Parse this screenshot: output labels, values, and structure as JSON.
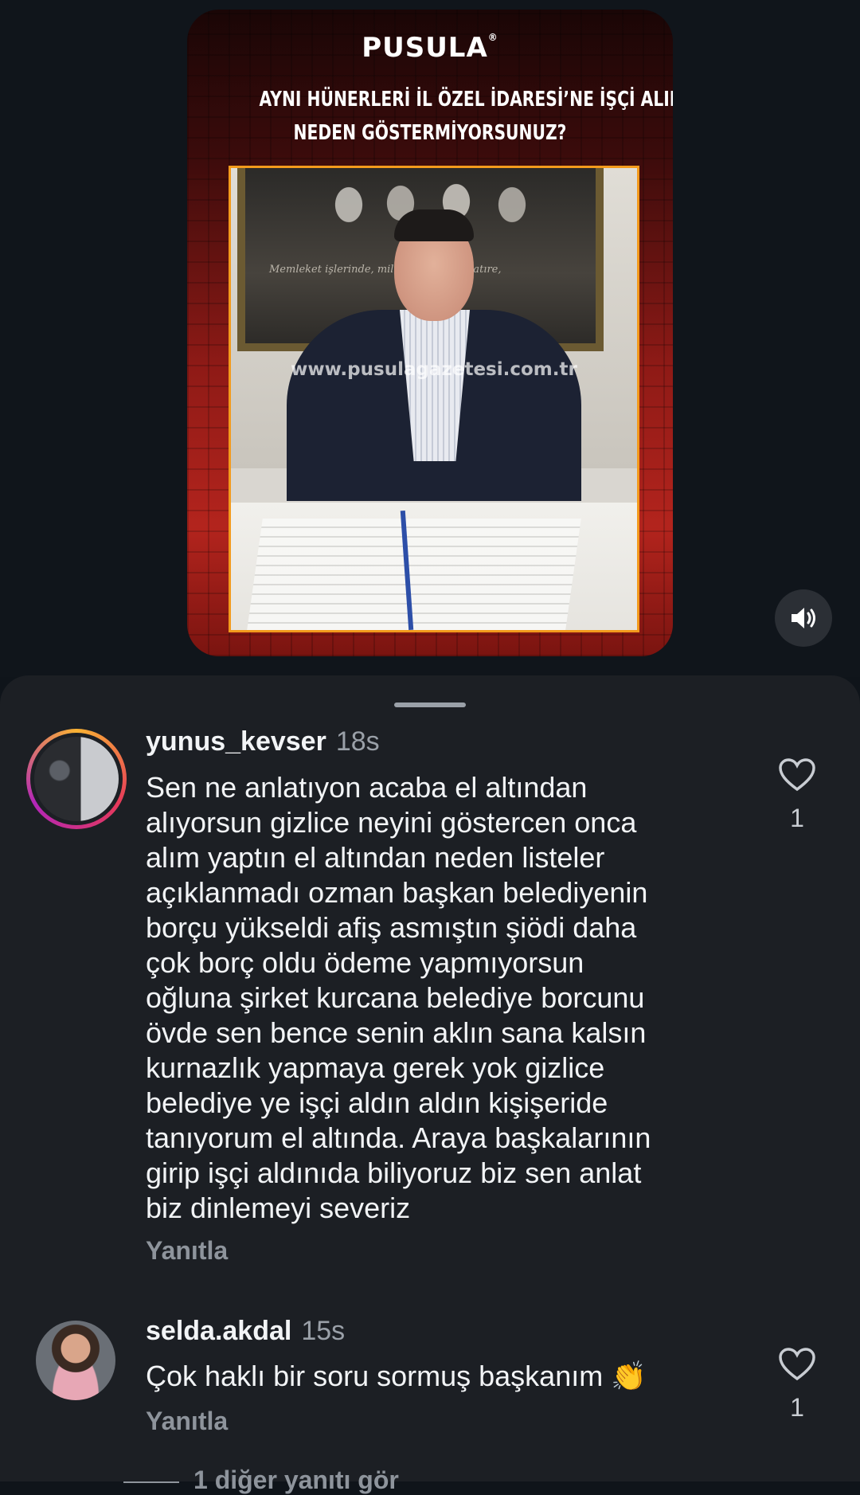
{
  "video": {
    "brand": "PUSULA",
    "brand_mark": "®",
    "headline_line1": "AYNI HÜNERLERİ İL ÖZEL İDARESİ’NE İŞÇİ ALINIRKEN",
    "headline_line2": "NEDEN GÖSTERMİYORSUNUZ?",
    "watermark": "www.pusulagazetesi.com.tr",
    "portrait_script": "Memleket işlerinde, millî ... doygoya, katıre,"
  },
  "sound_button": {
    "icon": "speaker-on-icon"
  },
  "comments": [
    {
      "username": "yunus_kevser",
      "time": "18s",
      "text": "Sen ne anlatıyon acaba el altından\nalıyorsun gizlice neyini göstercen onca\nalım yaptın el altından neden listeler\naçıklanmadı ozman başkan  belediyenin\nborçu yükseldi afiş asmıştın şiödi daha\nçok borç oldu ödeme yapmıyorsun\noğluna şirket kurcana belediye borcunu\növde sen bence senin aklın sana kalsın\nkurnazlık yapmaya gerek yok gizlice\nbelediye ye işçi aldın aldın kişişeride\ntanıyorum el altında. Araya başkalarının\ngirip işçi aldınıda biliyoruz biz sen anlat\nbiz dinlemeyi severiz",
      "reply_label": "Yanıtla",
      "likes": "1",
      "has_story_ring": true
    },
    {
      "username": "selda.akdal",
      "time": "15s",
      "text": "Çok haklı bir soru sormuş başkanım 👏",
      "reply_label": "Yanıtla",
      "likes": "1",
      "has_story_ring": false
    }
  ],
  "more_replies": "1 diğer yanıtı gör",
  "colors": {
    "background": "#0f141a",
    "sheet": "#1c1f24",
    "muted_text": "#8e949c",
    "accent_frame": "#f39a1c",
    "card_red": "#b3241d"
  }
}
